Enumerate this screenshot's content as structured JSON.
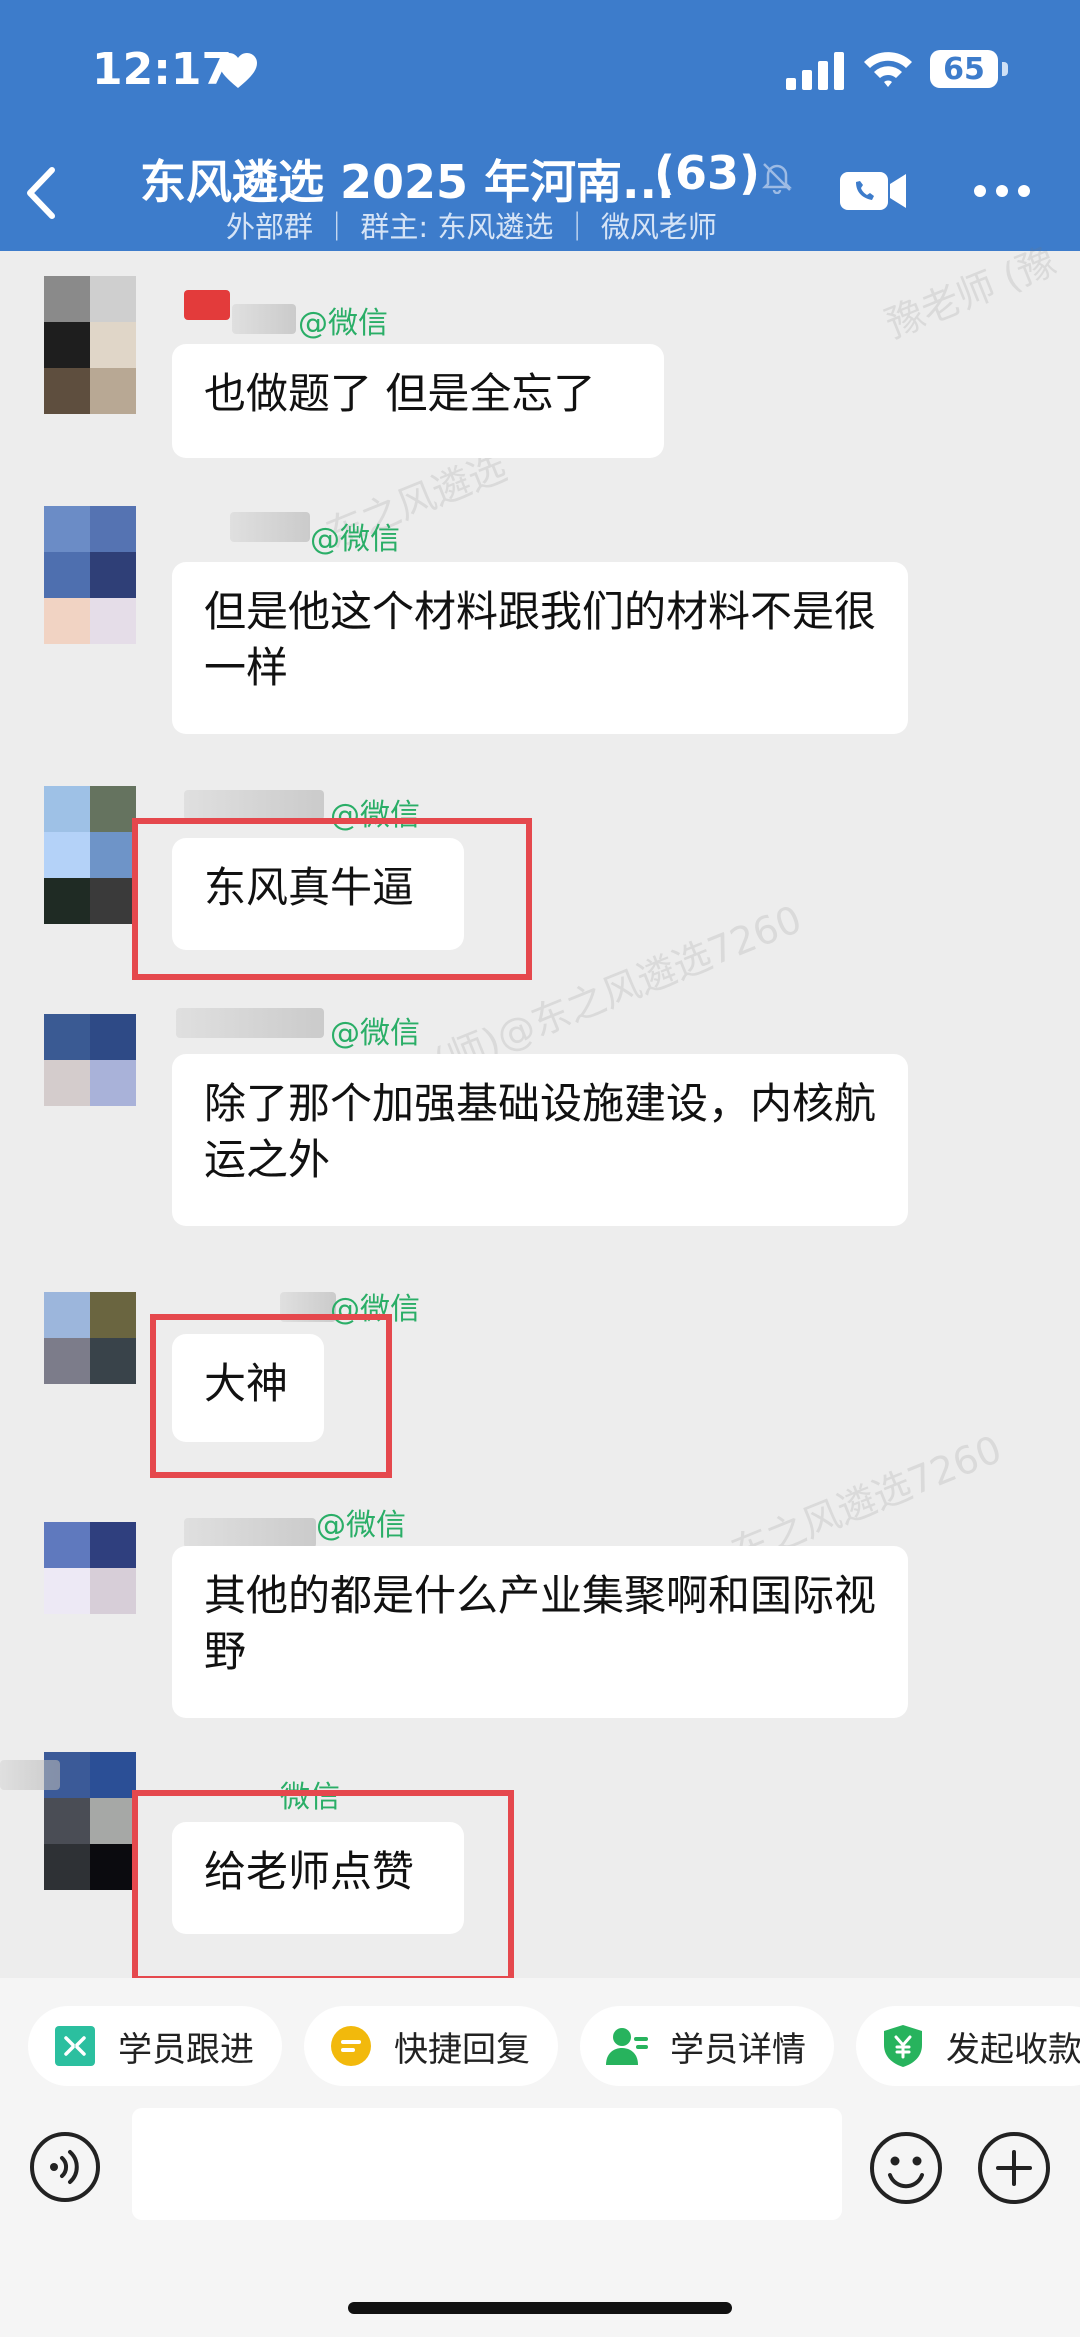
{
  "status_bar": {
    "time": "12:17",
    "battery": "65"
  },
  "header": {
    "title": "东风遴选 2025 年河南...",
    "member_count": "(63)",
    "subtitle": "外部群 ｜ 群主: 东风遴选 ｜ 微风老师"
  },
  "messages": [
    {
      "sender_tag": "@微信",
      "text": "也做题了 但是全忘了",
      "highlighted": false
    },
    {
      "sender_tag": "@微信",
      "text": "但是他这个材料跟我们的材料不是很一样",
      "highlighted": false
    },
    {
      "sender_tag": "@微信",
      "text": "东风真牛逼",
      "highlighted": true
    },
    {
      "sender_tag": "@微信",
      "text": "除了那个加强基础设施建设，内核航运之外",
      "highlighted": false
    },
    {
      "sender_tag": "@微信",
      "text": "大神",
      "highlighted": true
    },
    {
      "sender_tag": "@微信",
      "text": "其他的都是什么产业集聚啊和国际视野",
      "highlighted": false
    },
    {
      "sender_tag": "微信",
      "text": "给老师点赞",
      "highlighted": true
    }
  ],
  "watermarks": [
    "豫老师 (豫",
    "东之风遴选",
    "(师)@东之风遴选7260",
    "(师)@东之风遴选7260"
  ],
  "quick_actions": [
    {
      "label": "学员跟进",
      "icon": "student-followup-icon",
      "color": "#2BBF9F"
    },
    {
      "label": "快捷回复",
      "icon": "quick-reply-icon",
      "color": "#F2B90C"
    },
    {
      "label": "学员详情",
      "icon": "student-detail-icon",
      "color": "#27B35D"
    },
    {
      "label": "发起收款",
      "icon": "payment-icon",
      "color": "#27B35D"
    }
  ],
  "input": {
    "value": "",
    "placeholder": ""
  },
  "colors": {
    "header": "#3D7CCB",
    "highlight": "#E5484D",
    "wechat_green": "#2AAE67"
  }
}
